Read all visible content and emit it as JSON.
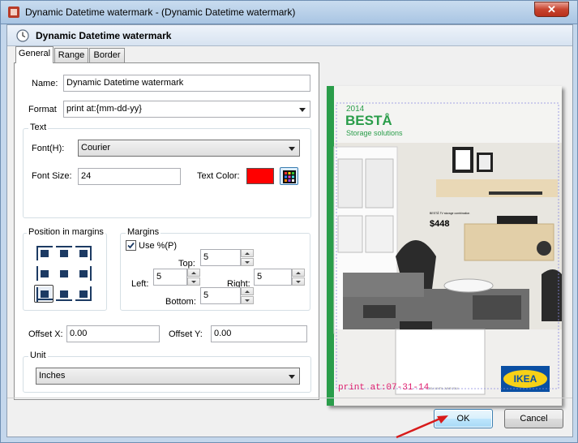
{
  "window": {
    "title": "Dynamic Datetime watermark - (Dynamic Datetime watermark)",
    "close_label": "✕"
  },
  "header": {
    "title": "Dynamic Datetime watermark"
  },
  "tabs": [
    {
      "label": "General"
    },
    {
      "label": "Range"
    },
    {
      "label": "Border"
    }
  ],
  "general": {
    "name_label": "Name:",
    "name_value": "Dynamic Datetime watermark",
    "format_label": "Format",
    "format_value": "print at:{mm-dd-yy}",
    "text_group": "Text",
    "font_label": "Font(H):",
    "font_value": "Courier",
    "font_size_label": "Font Size:",
    "font_size_value": "24",
    "text_color_label": "Text Color:",
    "text_color": "#ff0000",
    "position_group": "Position in margins",
    "margins_group": "Margins",
    "use_percent_label": "Use %(P)",
    "use_percent_checked": true,
    "top_label": "Top:",
    "top_value": "5",
    "left_label": "Left:",
    "left_value": "5",
    "right_label": "Right:",
    "right_value": "5",
    "bottom_label": "Bottom:",
    "bottom_value": "5",
    "offset_x_label": "Offset X:",
    "offset_x_value": "0.00",
    "offset_y_label": "Offset Y:",
    "offset_y_value": "0.00",
    "unit_group": "Unit",
    "unit_value": "Inches"
  },
  "preview": {
    "year": "2014",
    "brand": "BESTÅ",
    "subtitle": "Storage solutions",
    "price_caption": "BESTÅ TV storage combination",
    "price": "$448",
    "footer_small": "2014 UNTIL JUNE 2014",
    "logo": "IKEA",
    "watermark_text": "print at:07-31-14"
  },
  "buttons": {
    "ok": "OK",
    "cancel": "Cancel"
  },
  "colors": {
    "accent_green": "#2a9d4a",
    "ikea_blue": "#0a4fa3",
    "ikea_yellow": "#f7d117",
    "watermark": "#e0206f",
    "arrow": "#d81b1b"
  }
}
